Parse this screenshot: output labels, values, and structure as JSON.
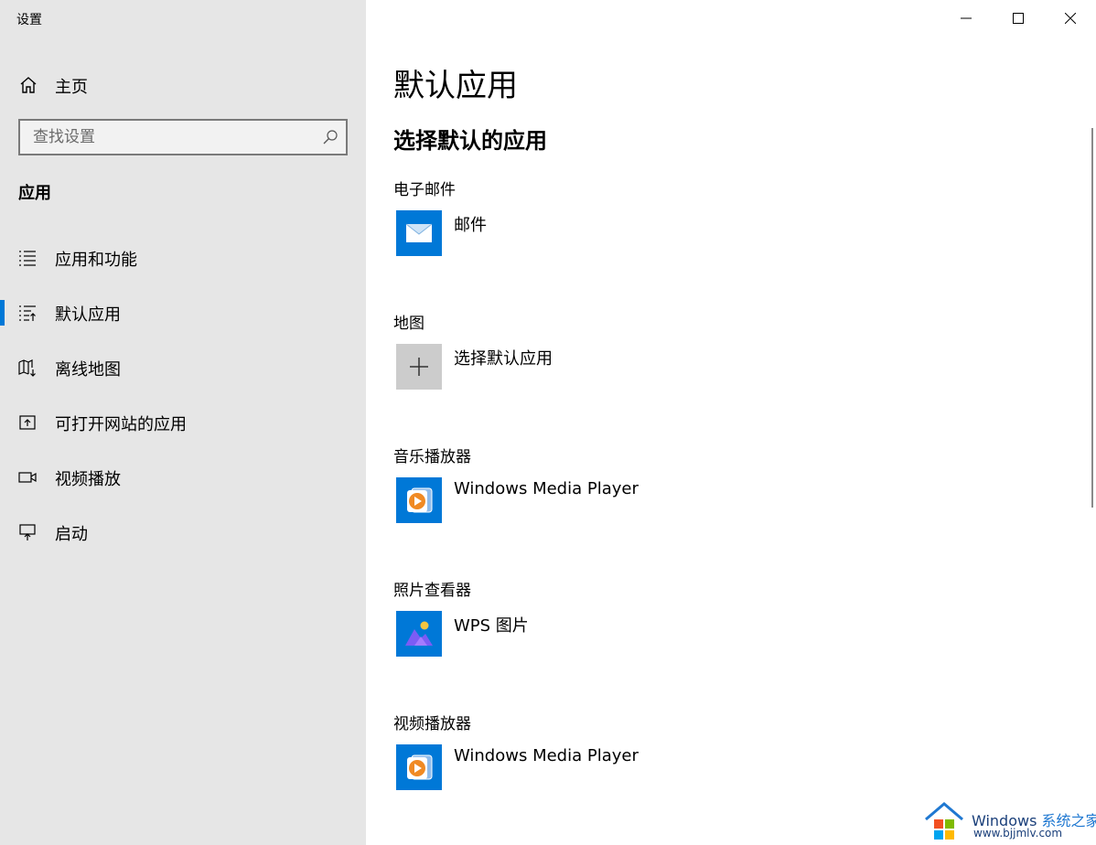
{
  "window": {
    "title": "设置"
  },
  "sidebar": {
    "home_label": "主页",
    "search": {
      "placeholder": "查找设置",
      "value": ""
    },
    "section_heading": "应用",
    "items": [
      {
        "label": "应用和功能",
        "icon": "apps-features-icon",
        "selected": false
      },
      {
        "label": "默认应用",
        "icon": "default-apps-icon",
        "selected": true
      },
      {
        "label": "离线地图",
        "icon": "offline-maps-icon",
        "selected": false
      },
      {
        "label": "可打开网站的应用",
        "icon": "apps-for-websites-icon",
        "selected": false
      },
      {
        "label": "视频播放",
        "icon": "video-playback-icon",
        "selected": false
      },
      {
        "label": "启动",
        "icon": "startup-icon",
        "selected": false
      }
    ]
  },
  "main": {
    "title": "默认应用",
    "subtitle": "选择默认的应用",
    "categories": [
      {
        "label": "电子邮件",
        "app": "邮件",
        "icon": "mail-icon"
      },
      {
        "label": "地图",
        "app": "选择默认应用",
        "icon": "plus-icon"
      },
      {
        "label": "音乐播放器",
        "app": "Windows Media Player",
        "icon": "windows-media-player-icon"
      },
      {
        "label": "照片查看器",
        "app": "WPS 图片",
        "icon": "wps-pictures-icon"
      },
      {
        "label": "视频播放器",
        "app": "Windows Media Player",
        "icon": "windows-media-player-icon"
      }
    ]
  },
  "watermark": {
    "brand": "Windows",
    "brand_accent": "系统之家",
    "url": "www.bjjmlv.com"
  },
  "colors": {
    "accent": "#0078d7",
    "sidebar_bg": "#e6e6e6",
    "plus_tile": "#cccccc"
  }
}
